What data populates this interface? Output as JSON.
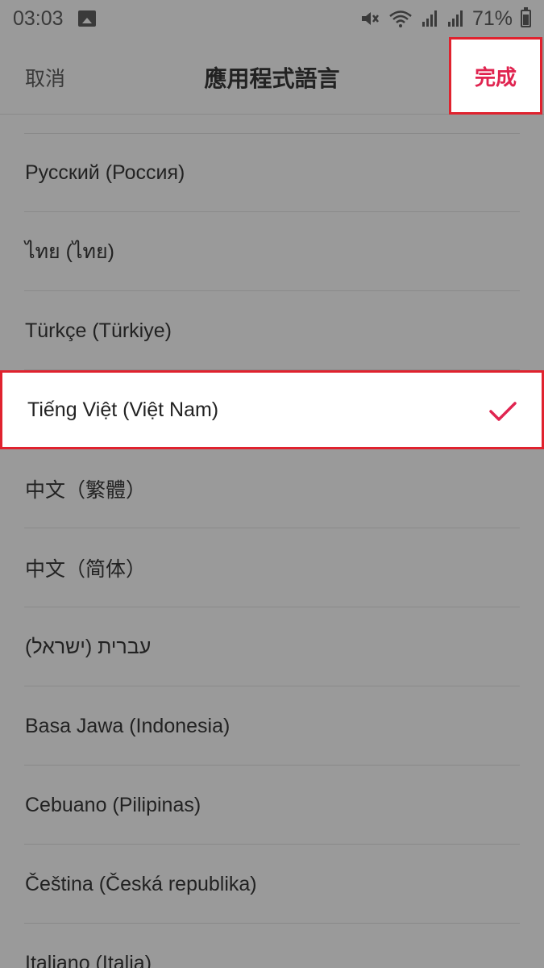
{
  "status_bar": {
    "time": "03:03",
    "battery": "71%",
    "icons": [
      "image-icon",
      "mute-icon",
      "wifi-icon",
      "signal-icon",
      "signal-icon",
      "battery-icon"
    ]
  },
  "header": {
    "cancel_label": "取消",
    "title": "應用程式語言",
    "done_label": "完成"
  },
  "colors": {
    "accent": "#e02450",
    "highlight_border": "#e0222e",
    "overlay_bg": "#9a9a9a"
  },
  "languages": [
    {
      "label": "Русский (Россия)",
      "selected": false
    },
    {
      "label": "ไทย (ไทย)",
      "selected": false
    },
    {
      "label": "Türkçe (Türkiye)",
      "selected": false
    },
    {
      "label": "Tiếng Việt (Việt Nam)",
      "selected": true
    },
    {
      "label": "中文（繁體）",
      "selected": false
    },
    {
      "label": "中文（简体）",
      "selected": false
    },
    {
      "label": "עברית (ישראל)",
      "selected": false
    },
    {
      "label": "Basa Jawa (Indonesia)",
      "selected": false
    },
    {
      "label": "Cebuano (Pilipinas)",
      "selected": false
    },
    {
      "label": "Čeština (Česká republika)",
      "selected": false
    },
    {
      "label": "Italiano (Italia)",
      "selected": false
    }
  ]
}
